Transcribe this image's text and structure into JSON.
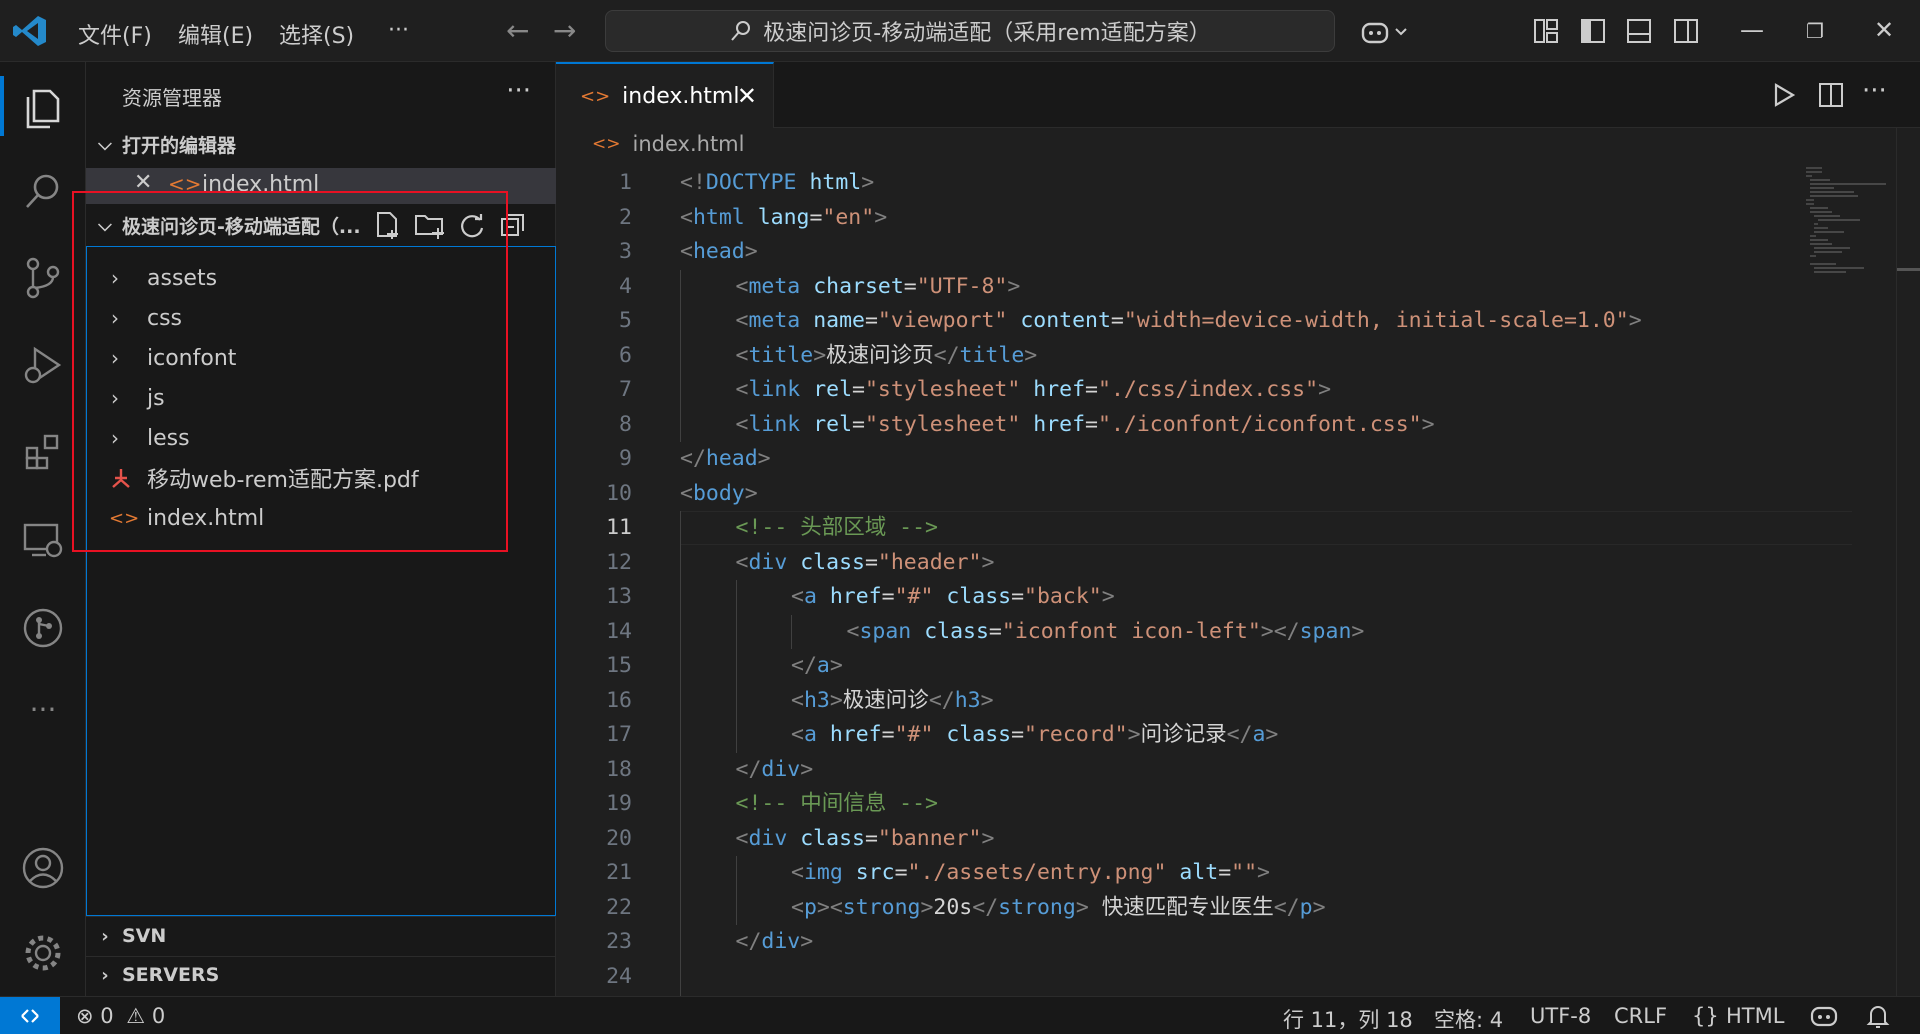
{
  "titlebar": {
    "menus": [
      "文件(F)",
      "编辑(E)",
      "选择(S)",
      "···"
    ],
    "search_text": "极速问诊页-移动端适配（采用rem适配方案）"
  },
  "sidebar": {
    "title": "资源管理器",
    "more": "···",
    "open_editors_label": "打开的编辑器",
    "open_editor_file": "index.html",
    "project_label": "极速问诊页-移动端适配（...",
    "tree": [
      {
        "name": "assets",
        "type": "folder"
      },
      {
        "name": "css",
        "type": "folder"
      },
      {
        "name": "iconfont",
        "type": "folder"
      },
      {
        "name": "js",
        "type": "folder"
      },
      {
        "name": "less",
        "type": "folder"
      },
      {
        "name": "移动web-rem适配方案.pdf",
        "type": "pdf"
      },
      {
        "name": "index.html",
        "type": "html"
      }
    ],
    "svn_label": "SVN",
    "servers_label": "SERVERS"
  },
  "editor": {
    "tab_label": "index.html",
    "breadcrumb": "index.html",
    "current_line": 11,
    "lines": [
      {
        "n": 1,
        "indent": 0,
        "parts": [
          [
            "t",
            "<!"
          ],
          [
            "tg",
            "DOCTYPE "
          ],
          [
            "at",
            "html"
          ],
          [
            "t",
            ">"
          ]
        ]
      },
      {
        "n": 2,
        "indent": 0,
        "parts": [
          [
            "t",
            "<"
          ],
          [
            "tg",
            "html "
          ],
          [
            "at",
            "lang"
          ],
          [
            "tx",
            "="
          ],
          [
            "st",
            "\"en\""
          ],
          [
            "t",
            ">"
          ]
        ]
      },
      {
        "n": 3,
        "indent": 0,
        "parts": [
          [
            "t",
            "<"
          ],
          [
            "tg",
            "head"
          ],
          [
            "t",
            ">"
          ]
        ]
      },
      {
        "n": 4,
        "indent": 1,
        "parts": [
          [
            "t",
            "<"
          ],
          [
            "tg",
            "meta "
          ],
          [
            "at",
            "charset"
          ],
          [
            "tx",
            "="
          ],
          [
            "st",
            "\"UTF-8\""
          ],
          [
            "t",
            ">"
          ]
        ]
      },
      {
        "n": 5,
        "indent": 1,
        "parts": [
          [
            "t",
            "<"
          ],
          [
            "tg",
            "meta "
          ],
          [
            "at",
            "name"
          ],
          [
            "tx",
            "="
          ],
          [
            "st",
            "\"viewport\" "
          ],
          [
            "at",
            "content"
          ],
          [
            "tx",
            "="
          ],
          [
            "st",
            "\"width=device-width, initial-scale=1.0\""
          ],
          [
            "t",
            ">"
          ]
        ]
      },
      {
        "n": 6,
        "indent": 1,
        "parts": [
          [
            "t",
            "<"
          ],
          [
            "tg",
            "title"
          ],
          [
            "t",
            ">"
          ],
          [
            "tx",
            "极速问诊页"
          ],
          [
            "t",
            "</"
          ],
          [
            "tg",
            "title"
          ],
          [
            "t",
            ">"
          ]
        ]
      },
      {
        "n": 7,
        "indent": 1,
        "parts": [
          [
            "t",
            "<"
          ],
          [
            "tg",
            "link "
          ],
          [
            "at",
            "rel"
          ],
          [
            "tx",
            "="
          ],
          [
            "st",
            "\"stylesheet\" "
          ],
          [
            "at",
            "href"
          ],
          [
            "tx",
            "="
          ],
          [
            "st",
            "\"./css/index.css\""
          ],
          [
            "t",
            ">"
          ]
        ]
      },
      {
        "n": 8,
        "indent": 1,
        "parts": [
          [
            "t",
            "<"
          ],
          [
            "tg",
            "link "
          ],
          [
            "at",
            "rel"
          ],
          [
            "tx",
            "="
          ],
          [
            "st",
            "\"stylesheet\" "
          ],
          [
            "at",
            "href"
          ],
          [
            "tx",
            "="
          ],
          [
            "st",
            "\"./iconfont/iconfont.css\""
          ],
          [
            "t",
            ">"
          ]
        ]
      },
      {
        "n": 9,
        "indent": 0,
        "parts": [
          [
            "t",
            "</"
          ],
          [
            "tg",
            "head"
          ],
          [
            "t",
            ">"
          ]
        ]
      },
      {
        "n": 10,
        "indent": 0,
        "parts": [
          [
            "t",
            "<"
          ],
          [
            "tg",
            "body"
          ],
          [
            "t",
            ">"
          ]
        ]
      },
      {
        "n": 11,
        "indent": 1,
        "parts": [
          [
            "cm",
            "<!-- 头部区域 -->"
          ]
        ]
      },
      {
        "n": 12,
        "indent": 1,
        "parts": [
          [
            "t",
            "<"
          ],
          [
            "tg",
            "div "
          ],
          [
            "at",
            "class"
          ],
          [
            "tx",
            "="
          ],
          [
            "st",
            "\"header\""
          ],
          [
            "t",
            ">"
          ]
        ]
      },
      {
        "n": 13,
        "indent": 2,
        "parts": [
          [
            "t",
            "<"
          ],
          [
            "tg",
            "a "
          ],
          [
            "at",
            "href"
          ],
          [
            "tx",
            "="
          ],
          [
            "st",
            "\"#\" "
          ],
          [
            "at",
            "class"
          ],
          [
            "tx",
            "="
          ],
          [
            "st",
            "\"back\""
          ],
          [
            "t",
            ">"
          ]
        ]
      },
      {
        "n": 14,
        "indent": 3,
        "parts": [
          [
            "t",
            "<"
          ],
          [
            "tg",
            "span "
          ],
          [
            "at",
            "class"
          ],
          [
            "tx",
            "="
          ],
          [
            "st",
            "\"iconfont icon-left\""
          ],
          [
            "t",
            "></"
          ],
          [
            "tg",
            "span"
          ],
          [
            "t",
            ">"
          ]
        ]
      },
      {
        "n": 15,
        "indent": 2,
        "parts": [
          [
            "t",
            "</"
          ],
          [
            "tg",
            "a"
          ],
          [
            "t",
            ">"
          ]
        ]
      },
      {
        "n": 16,
        "indent": 2,
        "parts": [
          [
            "t",
            "<"
          ],
          [
            "tg",
            "h3"
          ],
          [
            "t",
            ">"
          ],
          [
            "tx",
            "极速问诊"
          ],
          [
            "t",
            "</"
          ],
          [
            "tg",
            "h3"
          ],
          [
            "t",
            ">"
          ]
        ]
      },
      {
        "n": 17,
        "indent": 2,
        "parts": [
          [
            "t",
            "<"
          ],
          [
            "tg",
            "a "
          ],
          [
            "at",
            "href"
          ],
          [
            "tx",
            "="
          ],
          [
            "st",
            "\"#\" "
          ],
          [
            "at",
            "class"
          ],
          [
            "tx",
            "="
          ],
          [
            "st",
            "\"record\""
          ],
          [
            "t",
            ">"
          ],
          [
            "tx",
            "问诊记录"
          ],
          [
            "t",
            "</"
          ],
          [
            "tg",
            "a"
          ],
          [
            "t",
            ">"
          ]
        ]
      },
      {
        "n": 18,
        "indent": 1,
        "parts": [
          [
            "t",
            "</"
          ],
          [
            "tg",
            "div"
          ],
          [
            "t",
            ">"
          ]
        ]
      },
      {
        "n": 19,
        "indent": 1,
        "parts": [
          [
            "cm",
            "<!-- 中间信息 -->"
          ]
        ]
      },
      {
        "n": 20,
        "indent": 1,
        "parts": [
          [
            "t",
            "<"
          ],
          [
            "tg",
            "div "
          ],
          [
            "at",
            "class"
          ],
          [
            "tx",
            "="
          ],
          [
            "st",
            "\"banner\""
          ],
          [
            "t",
            ">"
          ]
        ]
      },
      {
        "n": 21,
        "indent": 2,
        "parts": [
          [
            "t",
            "<"
          ],
          [
            "tg",
            "img "
          ],
          [
            "at",
            "src"
          ],
          [
            "tx",
            "="
          ],
          [
            "st",
            "\"./assets/entry.png\" "
          ],
          [
            "at",
            "alt"
          ],
          [
            "tx",
            "="
          ],
          [
            "st",
            "\"\""
          ],
          [
            "t",
            ">"
          ]
        ]
      },
      {
        "n": 22,
        "indent": 2,
        "parts": [
          [
            "t",
            "<"
          ],
          [
            "tg",
            "p"
          ],
          [
            "t",
            "><"
          ],
          [
            "tg",
            "strong"
          ],
          [
            "t",
            ">"
          ],
          [
            "tx",
            "20s"
          ],
          [
            "t",
            "</"
          ],
          [
            "tg",
            "strong"
          ],
          [
            "t",
            ">"
          ],
          [
            "tx",
            " 快速匹配专业医生"
          ],
          [
            "t",
            "</"
          ],
          [
            "tg",
            "p"
          ],
          [
            "t",
            ">"
          ]
        ]
      },
      {
        "n": 23,
        "indent": 1,
        "parts": [
          [
            "t",
            "</"
          ],
          [
            "tg",
            "div"
          ],
          [
            "t",
            ">"
          ]
        ]
      },
      {
        "n": 24,
        "indent": 0,
        "parts": []
      }
    ]
  },
  "statusbar": {
    "errors": "0",
    "warnings": "0",
    "position": "行 11，列 18",
    "spaces": "空格: 4",
    "encoding": "UTF-8",
    "eol": "CRLF",
    "language": "HTML"
  },
  "colors": {
    "accent": "#0078d4",
    "highlight_box": "#e81123"
  }
}
